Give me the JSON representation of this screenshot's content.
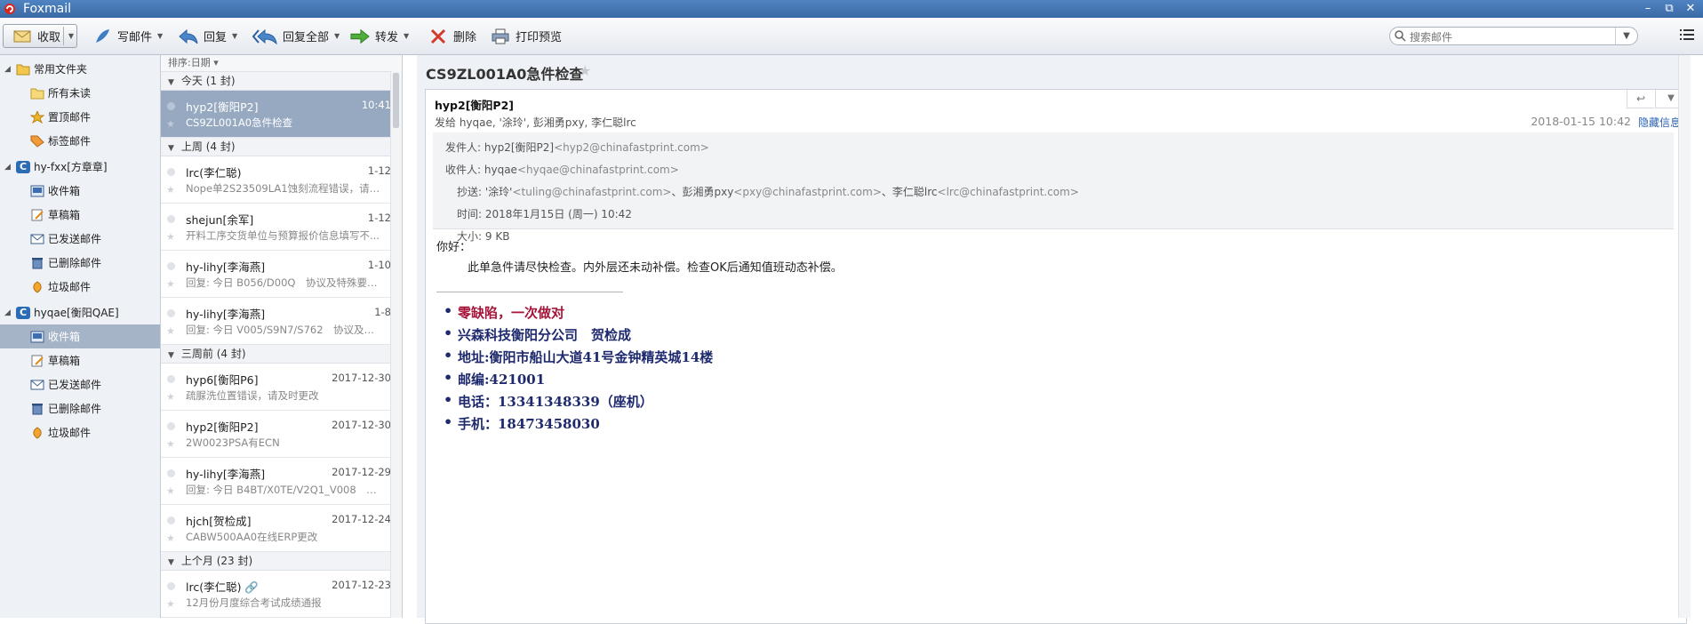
{
  "window": {
    "title": "Foxmail",
    "controls": [
      "–",
      "⧉",
      "✕"
    ]
  },
  "toolbar": {
    "receive": "收取",
    "compose": "写邮件",
    "reply": "回复",
    "reply_all": "回复全部",
    "forward": "转发",
    "delete": "删除",
    "print_preview": "打印预览",
    "search_placeholder": "搜索邮件"
  },
  "folders": {
    "common": "常用文件夹",
    "common_items": [
      "所有未读",
      "置顶邮件",
      "标签邮件"
    ],
    "account1": {
      "badge": "C",
      "name": "hy-fxx[方章章]",
      "items": [
        "收件箱",
        "草稿箱",
        "已发送邮件",
        "已删除邮件",
        "垃圾邮件"
      ]
    },
    "account2": {
      "badge": "C",
      "name": "hyqae[衡阳QAE]",
      "items": [
        "收件箱",
        "草稿箱",
        "已发送邮件",
        "已删除邮件",
        "垃圾邮件"
      ]
    }
  },
  "message_list": {
    "sort_label": "排序:日期 ▾",
    "groups": [
      {
        "label": "今天 (1 封)",
        "messages": [
          {
            "sender": "hyp2[衡阳P2]",
            "date": "10:41",
            "subject": "CS9ZL001A0急件检查",
            "selected": true
          }
        ]
      },
      {
        "label": "上周 (4 封)",
        "messages": [
          {
            "sender": "lrc(李仁聪)",
            "date": "1-12",
            "subject": "Nope单2S23509LA1蚀刻流程错误，请第..."
          },
          {
            "sender": "shejun[余军]",
            "date": "1-12",
            "subject": "开料工序交货单位与预算报价信息填写不..."
          },
          {
            "sender": "hy-lihy[李海燕]",
            "date": "1-10",
            "subject": "回复: 今日 B056/D00Q　协议及特殊要求..."
          },
          {
            "sender": "hy-lihy[李海燕]",
            "date": "1-8",
            "subject": "回复: 今日 V005/S9N7/S762　协议及特..."
          }
        ]
      },
      {
        "label": "三周前 (4 封)",
        "messages": [
          {
            "sender": "hyp6[衡阳P6]",
            "date": "2017-12-30",
            "subject": "疏脲洗位置错误，请及时更改"
          },
          {
            "sender": "hyp2[衡阳P2]",
            "date": "2017-12-30",
            "subject": "2W0023PSA有ECN"
          },
          {
            "sender": "hy-lihy[李海燕]",
            "date": "2017-12-29",
            "subject": "回复: 今日 B4BT/X0TE/V2Q1_V008　协..."
          },
          {
            "sender": "hjch[贺检成]",
            "date": "2017-12-24",
            "subject": "CABW500AA0在线ERP更改"
          }
        ]
      },
      {
        "label": "上个月 (23 封)",
        "messages": [
          {
            "sender": "lrc(李仁聪) 🔗",
            "date": "2017-12-23",
            "subject": "12月份月度综合考试成绩通报"
          }
        ]
      }
    ]
  },
  "reader": {
    "subject": "CS9ZL001A0急件检查",
    "from_name": "hyp2[衡阳P2]",
    "sent_to": "发给 hyqae, '涂玲', 彭湘勇pxy, 李仁聪lrc",
    "time_short": "2018-01-15 10:42",
    "hide_info": "隐藏信息",
    "details": {
      "from_label": "发件人:",
      "from_name": "hyp2[衡阳P2]",
      "from_email": "<hyp2@chinafastprint.com>",
      "to_label": "收件人:",
      "to_name": "hyqae",
      "to_email": "<hyqae@chinafastprint.com>",
      "cc_label": "抄送:",
      "cc1_name": "'涂玲'",
      "cc1_email": "<tuling@chinafastprint.com>",
      "cc2_name": "、彭湘勇pxy",
      "cc2_email": "<pxy@chinafastprint.com>",
      "cc3_name": "、李仁聪lrc",
      "cc3_email": "<lrc@chinafastprint.com>",
      "time_label": "时间:",
      "time_value": "2018年1月15日 (周一) 10:42",
      "size_label": "大小:",
      "size_value": "9 KB"
    },
    "body": {
      "greeting": "你好：",
      "content": "此单急件请尽快检查。内外层还未动补偿。检查OK后通知值班动态补偿。"
    },
    "signature": [
      "零缺陷，一次做对",
      "兴森科技衡阳分公司　贺检成",
      "地址:衡阳市船山大道41号金钟精英城14楼",
      "邮编:421001",
      "电话：13341348339（座机）",
      "手机：18473458030"
    ]
  }
}
